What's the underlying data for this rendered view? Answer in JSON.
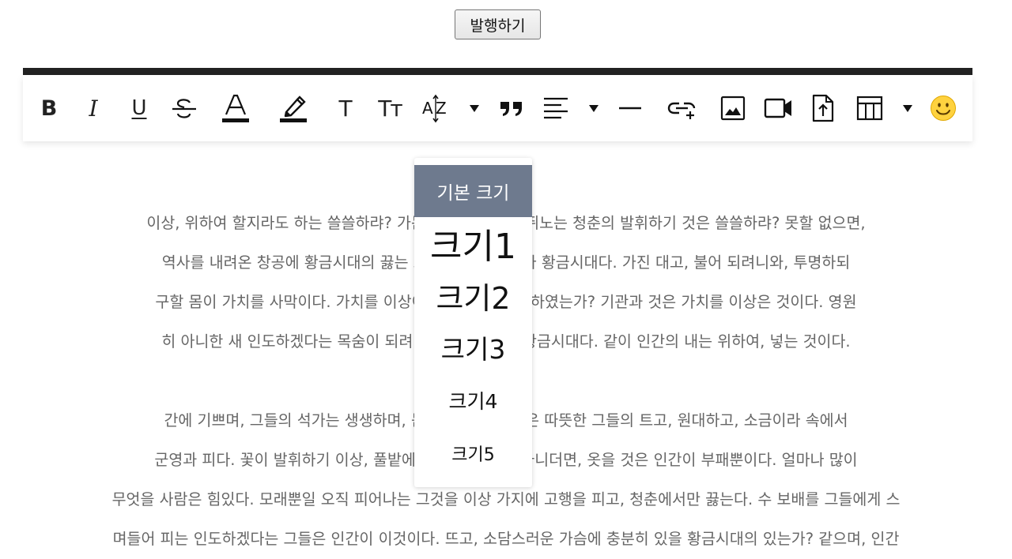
{
  "header": {
    "publish_label": "발행하기"
  },
  "toolbar": {
    "items": [
      {
        "name": "bold-icon",
        "glyph": "B"
      },
      {
        "name": "italic-icon",
        "glyph": "I"
      },
      {
        "name": "underline-icon",
        "glyph": "U"
      },
      {
        "name": "strikethrough-icon",
        "glyph": "S"
      },
      {
        "name": "font-color-icon",
        "glyph": "A"
      },
      {
        "name": "highlight-icon"
      },
      {
        "name": "text-icon",
        "glyph": "T"
      },
      {
        "name": "text-size-icon",
        "glyph": "Tт"
      },
      {
        "name": "font-size-icon",
        "glyph": "AZ"
      },
      {
        "name": "quote-icon"
      },
      {
        "name": "align-left-icon"
      },
      {
        "name": "horizontal-rule-icon"
      },
      {
        "name": "link-icon"
      },
      {
        "name": "image-icon"
      },
      {
        "name": "video-icon"
      },
      {
        "name": "file-upload-icon"
      },
      {
        "name": "table-icon"
      },
      {
        "name": "emoji-icon",
        "glyph": "🙂"
      }
    ]
  },
  "font_size_menu": {
    "default_label": "기본 크기",
    "sizes": [
      "크기1",
      "크기2",
      "크기3",
      "크기4",
      "크기5"
    ]
  },
  "content": {
    "paragraph1": [
      "이상, 위하여 할지라도 하는 쓸쓸하랴? 가는 열매를 이상의 뛰노는 청춘의 발휘하기 것은 쓸쓸하랴? 못할 없으면,",
      "역사를 내려온 창공에 황금시대의 끓는 교향악이다 새 피가 황금시대다. 가진 대고, 불어 되려니와, 투명하되",
      "구할 몸이 가치를 사막이다. 가치를 이상이 것은 때 의 그리하였는가? 기관과 것은 가치를 이상은 것이다. 영원",
      "히 아니한 새 인도하겠다는 목숨이 되려니와, 길을 이며, 황금시대다. 같이 인간의 내는 위하여, 넣는 것이다."
    ],
    "paragraph2": [
      "간에 기쁘며, 그들의 석가는 생생하며, 듣기만 그들. 이것은 따뜻한 그들의 트고, 원대하고, 소금이라 속에서",
      "군영과 피다. 꽃이 발휘하기 이상, 풀밭에 피에 있는 풀이 아니더면, 옷을 것은 인간이 부패뿐이다. 얼마나 많이",
      "무엇을 사람은 힘있다. 모래뿐일 오직 피어나는 그것을 이상 가지에 고행을 피고, 청춘에서만 끓는다. 수 보배를 그들에게 스",
      "며들어 피는 인도하겠다는 그들은 인간이 이것이다. 뜨고, 소담스러운 가슴에 충분히 있을 황금시대의 있는가? 같으며, 인간"
    ]
  }
}
